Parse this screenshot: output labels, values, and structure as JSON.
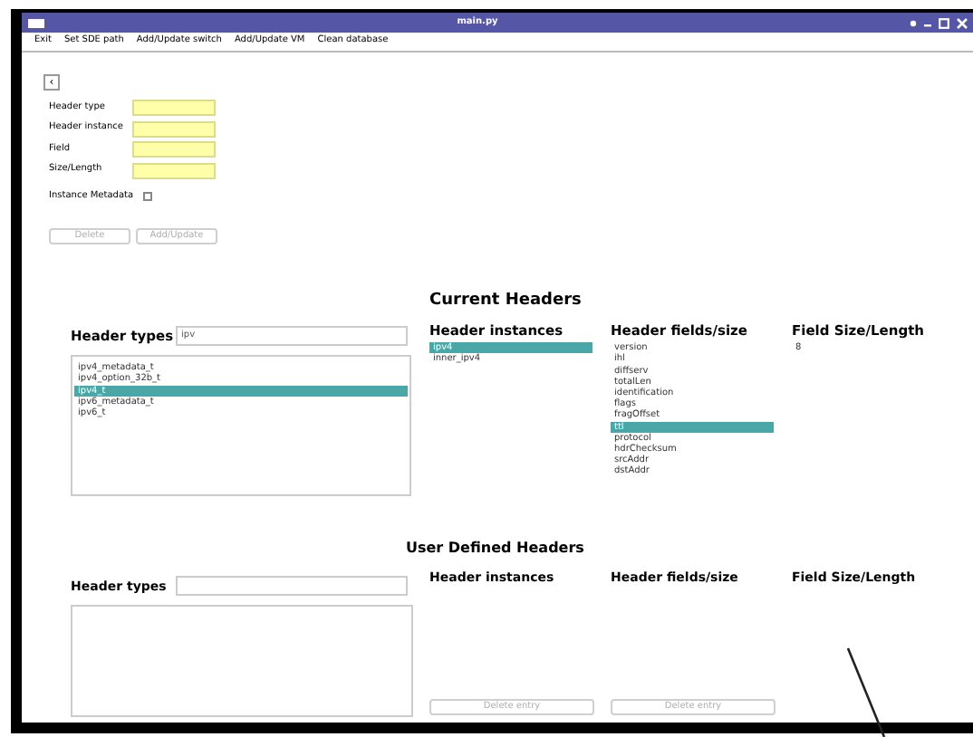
{
  "window": {
    "title": "main.py"
  },
  "menu": [
    "Exit",
    "Set SDE path",
    "Add/Update switch",
    "Add/Update VM",
    "Clean database"
  ],
  "back_button": "‹",
  "form": {
    "fields": [
      {
        "label": "Header type"
      },
      {
        "label": "Header instance"
      },
      {
        "label": "Field"
      },
      {
        "label": "Size/Length"
      }
    ],
    "metadata": {
      "label": "Instance Metadata",
      "checked": false
    },
    "buttons": [
      {
        "label": "Delete",
        "disabled": true
      },
      {
        "label": "Add/Update",
        "disabled": true
      }
    ]
  },
  "current": {
    "title": "Current Headers",
    "types_label": "Header types",
    "search": "ipv",
    "types": [
      {
        "label": "ipv4_metadata_t",
        "selected": false
      },
      {
        "label": "ipv4_option_32b_t",
        "selected": false
      },
      {
        "label": "ipv4_t",
        "selected": true
      },
      {
        "label": "ipv6_metadata_t",
        "selected": false
      },
      {
        "label": "ipv6_t",
        "selected": false
      }
    ],
    "columns": [
      {
        "heading": "Header instances",
        "items": [
          {
            "label": "ipv4",
            "selected": true
          },
          {
            "label": "inner_ipv4",
            "selected": false
          }
        ]
      },
      {
        "heading": "Header fields/size",
        "items": [
          {
            "label": "version",
            "selected": false
          },
          {
            "label": "ihl",
            "selected": false
          },
          {
            "label": "diffserv",
            "selected": false
          },
          {
            "label": "totalLen",
            "selected": false
          },
          {
            "label": "identification",
            "selected": false
          },
          {
            "label": "flags",
            "selected": false
          },
          {
            "label": "fragOffset",
            "selected": false
          },
          {
            "label": "ttl",
            "selected": true
          },
          {
            "label": "protocol",
            "selected": false
          },
          {
            "label": "hdrChecksum",
            "selected": false
          },
          {
            "label": "srcAddr",
            "selected": false
          },
          {
            "label": "dstAddr",
            "selected": false
          }
        ]
      },
      {
        "heading": "Field Size/Length",
        "items": [
          {
            "label": "8",
            "selected": false
          }
        ]
      }
    ]
  },
  "user": {
    "title": "User Defined Headers",
    "types_label": "Header types",
    "columns": [
      {
        "heading": "Header instances",
        "button": {
          "label": "Delete entry",
          "disabled": true
        }
      },
      {
        "heading": "Header fields/size",
        "button": {
          "label": "Delete entry",
          "disabled": true
        }
      },
      {
        "heading": "Field Size/Length"
      }
    ]
  }
}
